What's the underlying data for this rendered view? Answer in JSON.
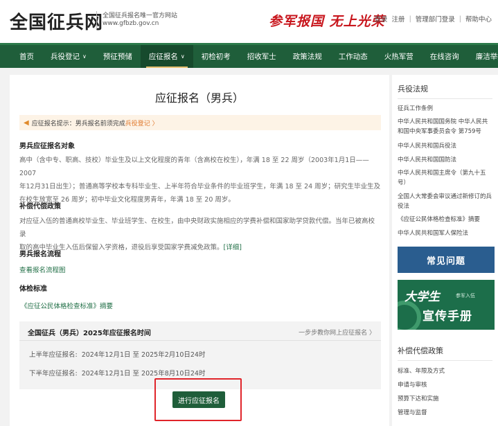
{
  "header": {
    "logo": "全国征兵网",
    "subtitle_line1": "全国征兵报名唯一官方网站",
    "subtitle_line2": "www.gfbzb.gov.cn",
    "slogan": "参军报国  无上光荣",
    "links": [
      "登录",
      "注册",
      "管理部门登录",
      "帮助中心"
    ]
  },
  "nav": {
    "items": [
      {
        "label": "首页",
        "dropdown": false,
        "active": false
      },
      {
        "label": "兵役登记",
        "dropdown": true,
        "active": false
      },
      {
        "label": "预征预储",
        "dropdown": false,
        "active": false
      },
      {
        "label": "应征报名",
        "dropdown": true,
        "active": true
      },
      {
        "label": "初检初考",
        "dropdown": false,
        "active": false
      },
      {
        "label": "招收军士",
        "dropdown": false,
        "active": false
      },
      {
        "label": "政策法规",
        "dropdown": false,
        "active": false
      },
      {
        "label": "工作动态",
        "dropdown": false,
        "active": false
      },
      {
        "label": "火热军营",
        "dropdown": false,
        "active": false
      },
      {
        "label": "在线咨询",
        "dropdown": false,
        "active": false
      },
      {
        "label": "廉洁举报",
        "dropdown": false,
        "active": false
      }
    ]
  },
  "main": {
    "title": "应征报名（男兵）",
    "tip": {
      "text": "应征报名提示：男兵报名前须完成",
      "link": "兵役登记 〉"
    },
    "sections": {
      "target_heading": "男兵应征报名对象",
      "target_lines": [
        "高中（含中专、职高、技校）毕业生及以上文化程度的青年（含高校在校生），年满 18 至 22 周岁（2003年1月1日——2007",
        "年12月31日出生）；普通高等学校本专科毕业生、上半年符合毕业条件的毕业班学生，年满 18 至 24 周岁；研究生毕业生及",
        "在校生放宽至 26 周岁；初中毕业文化程度男青年，年满 18 至 20 周岁。"
      ],
      "compensation_heading": "补偿代偿政策",
      "compensation_lines": [
        "对应征入伍的普通高校毕业生、毕业班学生、在校生，由中央财政实施相应的学费补偿和国家助学贷款代偿。当年已被高校录",
        "取的高中毕业生入伍后保留入学资格，退役后享受国家学费减免政策。"
      ],
      "compensation_more": "[详细]",
      "process_heading": "男兵报名流程",
      "process_link": "查看报名流程图",
      "physical_heading": "体检标准",
      "physical_link": "《应征公民体格检查标准》摘要"
    },
    "schedule": {
      "title": "全国征兵（男兵）2025年应征报名时间",
      "guide": "一步步教你网上应征报名  〉",
      "rows": [
        {
          "label": "上半年应征报名:",
          "value": "2024年12月1日 至 2025年2月10日24时"
        },
        {
          "label": "下半年应征报名:",
          "value": "2024年12月1日 至 2025年8月10日24时"
        }
      ]
    },
    "apply_button": "进行应征报名"
  },
  "sidebar": {
    "law_heading": "兵役法规",
    "law_links": [
      "征兵工作条例",
      "中华人民共和国国务院 中华人民共和国中央军事委员会令 第759号",
      "中华人民共和国兵役法",
      "中华人民共和国国防法",
      "中华人民共和国主席令（第九十五号）",
      "全国人大常委会审议通过新修订的兵役法",
      "《应征公民体格检查标准》摘要",
      "中华人民共和国军人保险法"
    ],
    "faq_banner": "常见问题",
    "brochure_banner": {
      "line1": "大学生",
      "line2": "参军入伍",
      "line3": "宣传手册"
    },
    "comp_heading": "补偿代偿政策",
    "comp_links": [
      "标准、年限及方式",
      "申请与审核",
      "预算下达和实施",
      "管理与监督"
    ]
  },
  "colors": {
    "nav_green": "#1f5e3a",
    "accent_red": "#c8161d",
    "highlight_red": "#e0242a",
    "link_green": "#1f6e45",
    "tip_orange": "#e0782b"
  }
}
